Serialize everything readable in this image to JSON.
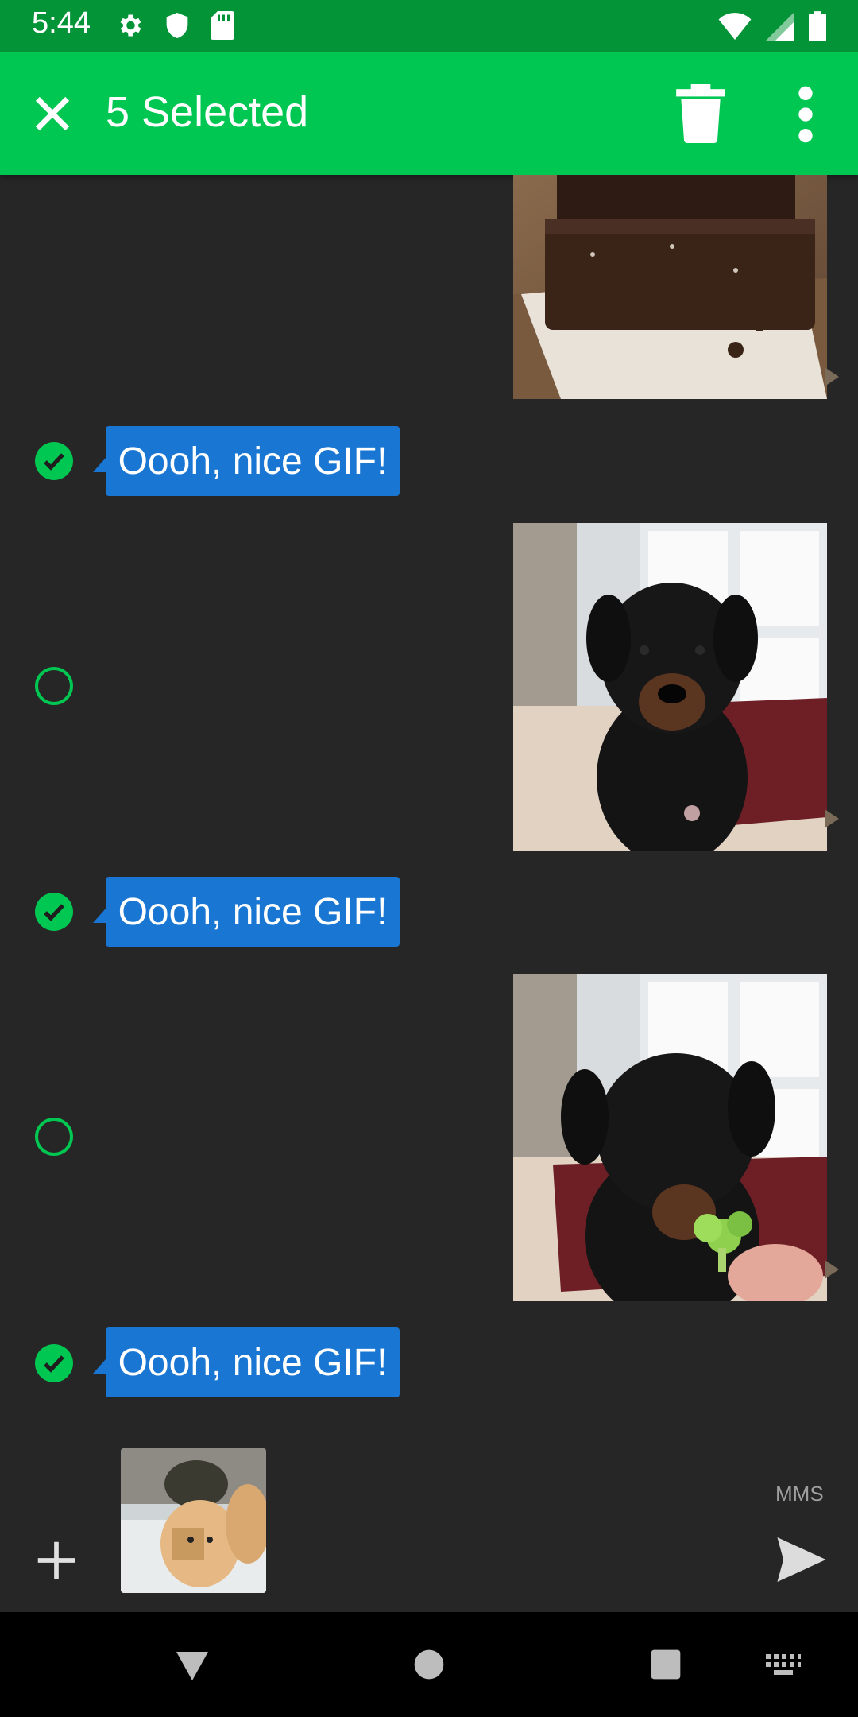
{
  "status_bar": {
    "time": "5:44"
  },
  "app_bar": {
    "title": "5 Selected"
  },
  "messages": {
    "bubble_1": "Oooh, nice GIF!",
    "bubble_2": "Oooh, nice GIF!",
    "bubble_3": "Oooh, nice GIF!"
  },
  "composer": {
    "type_label": "MMS"
  },
  "colors": {
    "accent": "#00c652",
    "status_bar": "#049438",
    "bubble": "#1976d2",
    "background": "#262626"
  },
  "icons": {
    "close": "close-icon",
    "delete": "trash-icon",
    "more": "more-vertical-icon",
    "add": "plus-icon",
    "send": "send-icon"
  }
}
